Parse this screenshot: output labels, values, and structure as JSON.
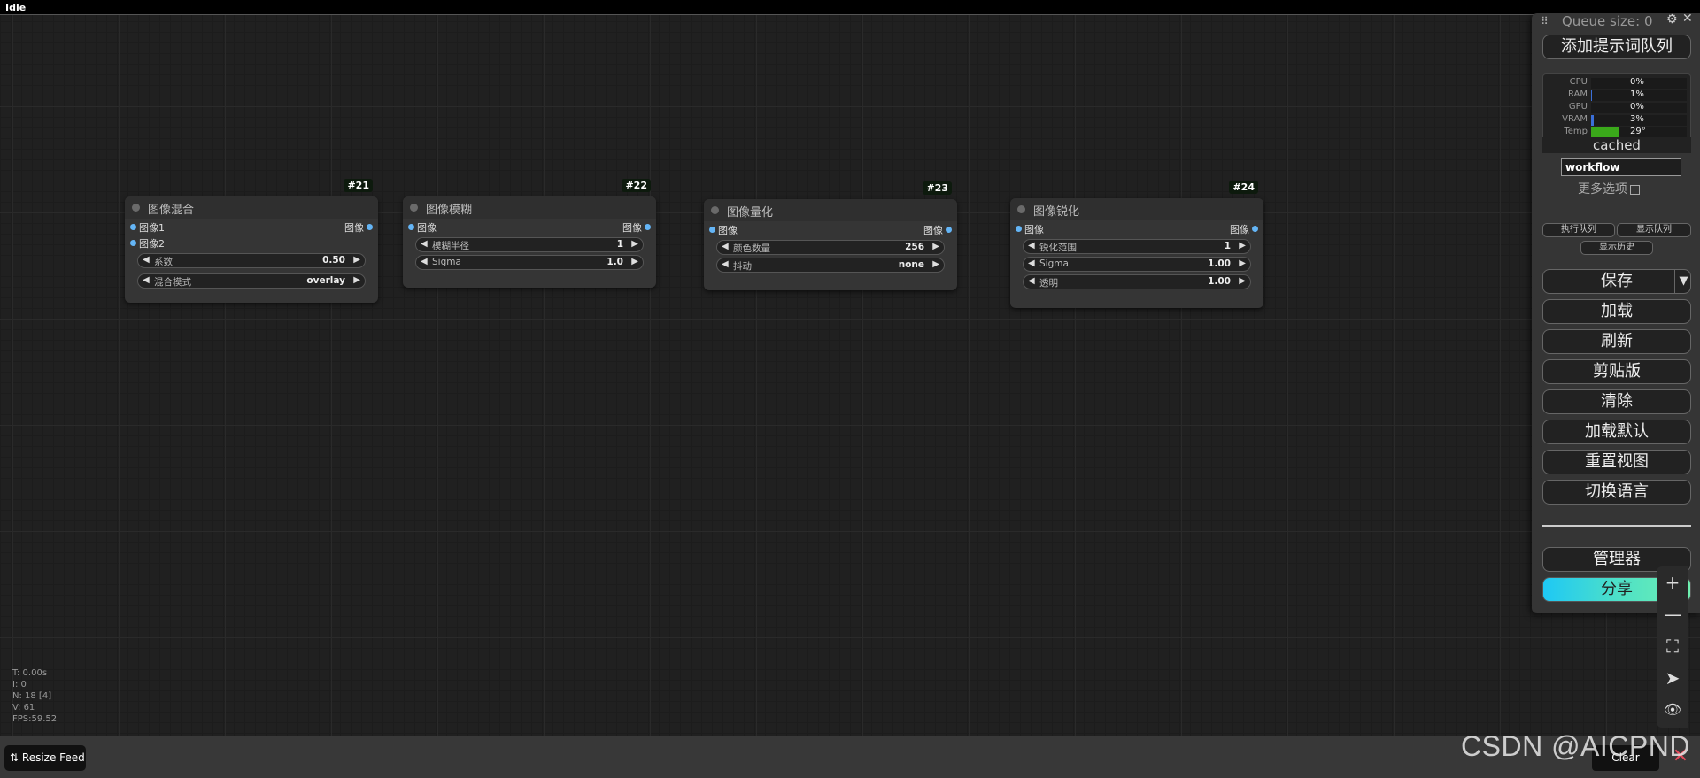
{
  "status": {
    "label": "Idle"
  },
  "nodes": [
    {
      "id": "#21",
      "title": "图像混合",
      "inputs": [
        "图像1",
        "图像2"
      ],
      "output": "图像",
      "widgets": [
        {
          "label": "系数",
          "value": "0.50"
        },
        {
          "label": "混合模式",
          "value": "overlay"
        }
      ]
    },
    {
      "id": "#22",
      "title": "图像模糊",
      "inputs": [
        "图像"
      ],
      "output": "图像",
      "widgets": [
        {
          "label": "模糊半径",
          "value": "1"
        },
        {
          "label": "Sigma",
          "value": "1.0"
        }
      ]
    },
    {
      "id": "#23",
      "title": "图像量化",
      "inputs": [
        "图像"
      ],
      "output": "图像",
      "widgets": [
        {
          "label": "颜色数量",
          "value": "256"
        },
        {
          "label": "抖动",
          "value": "none"
        }
      ]
    },
    {
      "id": "#24",
      "title": "图像锐化",
      "inputs": [
        "图像"
      ],
      "output": "图像",
      "widgets": [
        {
          "label": "锐化范围",
          "value": "1"
        },
        {
          "label": "Sigma",
          "value": "1.00"
        },
        {
          "label": "透明",
          "value": "1.00"
        }
      ]
    }
  ],
  "menu": {
    "queue_size": "Queue size: 0",
    "queue_prompt": "添加提示词队列",
    "stats": [
      {
        "label": "CPU",
        "value": "0%",
        "fill": 0,
        "color": "#3b6fd8"
      },
      {
        "label": "RAM",
        "value": "1%",
        "fill": 0.01,
        "color": "#3b6fd8"
      },
      {
        "label": "GPU",
        "value": "0%",
        "fill": 0,
        "color": "#3b6fd8"
      },
      {
        "label": "VRAM",
        "value": "3%",
        "fill": 0.03,
        "color": "#3b6fd8"
      },
      {
        "label": "Temp",
        "value": "29°",
        "fill": 0.29,
        "color": "#3aa81a"
      }
    ],
    "cached": "cached",
    "workflow_value": "workflow",
    "more_options": "更多选项",
    "run_queue": "执行队列",
    "show_queue": "显示队列",
    "show_history": "显示历史",
    "save": "保存",
    "save_arrow": "▼",
    "load": "加载",
    "refresh": "刷新",
    "clipspace": "剪贴版",
    "clear": "清除",
    "load_default": "加载默认",
    "reset_view": "重置视图",
    "switch_lang": "切换语言",
    "manager": "管理器",
    "share": "分享"
  },
  "zoom_controls": [
    "+",
    "—",
    "⛶",
    "➤",
    "👁"
  ],
  "canvas_info": [
    "T: 0.00s",
    "I: 0",
    "N: 18 [4]",
    "V: 61",
    "FPS:59.52"
  ],
  "bottom": {
    "resize_feed": "Resize Feed",
    "clear": "Clear",
    "close": "✕"
  },
  "watermark": "CSDN @AICPND"
}
